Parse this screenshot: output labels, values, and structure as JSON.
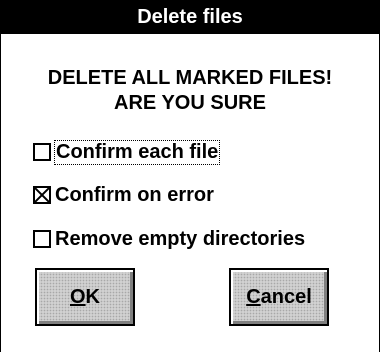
{
  "dialog": {
    "title": "Delete files",
    "message_line1": "DELETE ALL MARKED FILES!",
    "message_line2": "ARE YOU SURE"
  },
  "options": [
    {
      "label": "Confirm each file",
      "checked": false,
      "focused": true
    },
    {
      "label": "Confirm on error",
      "checked": true,
      "focused": false
    },
    {
      "label": "Remove empty directories",
      "checked": false,
      "focused": false
    }
  ],
  "buttons": {
    "ok": {
      "mnemonic": "O",
      "rest": "K"
    },
    "cancel": {
      "mnemonic": "C",
      "rest": "ancel"
    }
  }
}
